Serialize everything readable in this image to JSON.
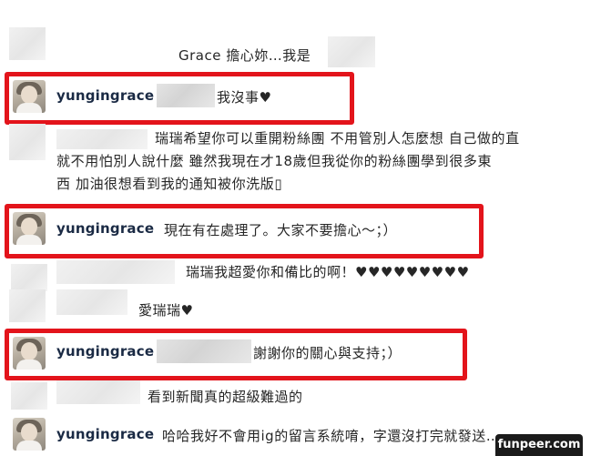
{
  "comments": [
    {
      "id": "c1",
      "text": "Grace 擔心妳…我是"
    },
    {
      "id": "c2",
      "username": "yungingrace",
      "text": "我沒事♥",
      "highlighted": true
    },
    {
      "id": "c3",
      "lines": [
        "瑞瑞希望你可以重開粉絲團 不用管別人怎麼想 自己做的直",
        "就不用怕別人說什麼 雖然我現在才18歲但我從你的粉絲團學到很多東",
        "西 加油很想看到我的通知被你洗版▯"
      ]
    },
    {
      "id": "c4",
      "username": "yungingrace",
      "text": "現在有在處理了。大家不要擔心～；）",
      "highlighted": true
    },
    {
      "id": "c5",
      "text": "瑞瑞我超愛你和備比的啊！♥♥♥♥♥♥♥♥♥"
    },
    {
      "id": "c6",
      "text": "愛瑞瑞♥"
    },
    {
      "id": "c7",
      "username": "yungingrace",
      "text": "謝謝你的關心與支持；）",
      "highlighted": true
    },
    {
      "id": "c8",
      "text": "看到新聞真的超級難過的"
    },
    {
      "id": "c9",
      "username": "yungingrace",
      "text": "哈哈我好不會用ig的留言系統唷，字還沒打完就發送…"
    }
  ],
  "watermark": "funpeer.com",
  "colors": {
    "highlight": "#e3141b",
    "username": "#1a2a44",
    "text": "#262626"
  }
}
